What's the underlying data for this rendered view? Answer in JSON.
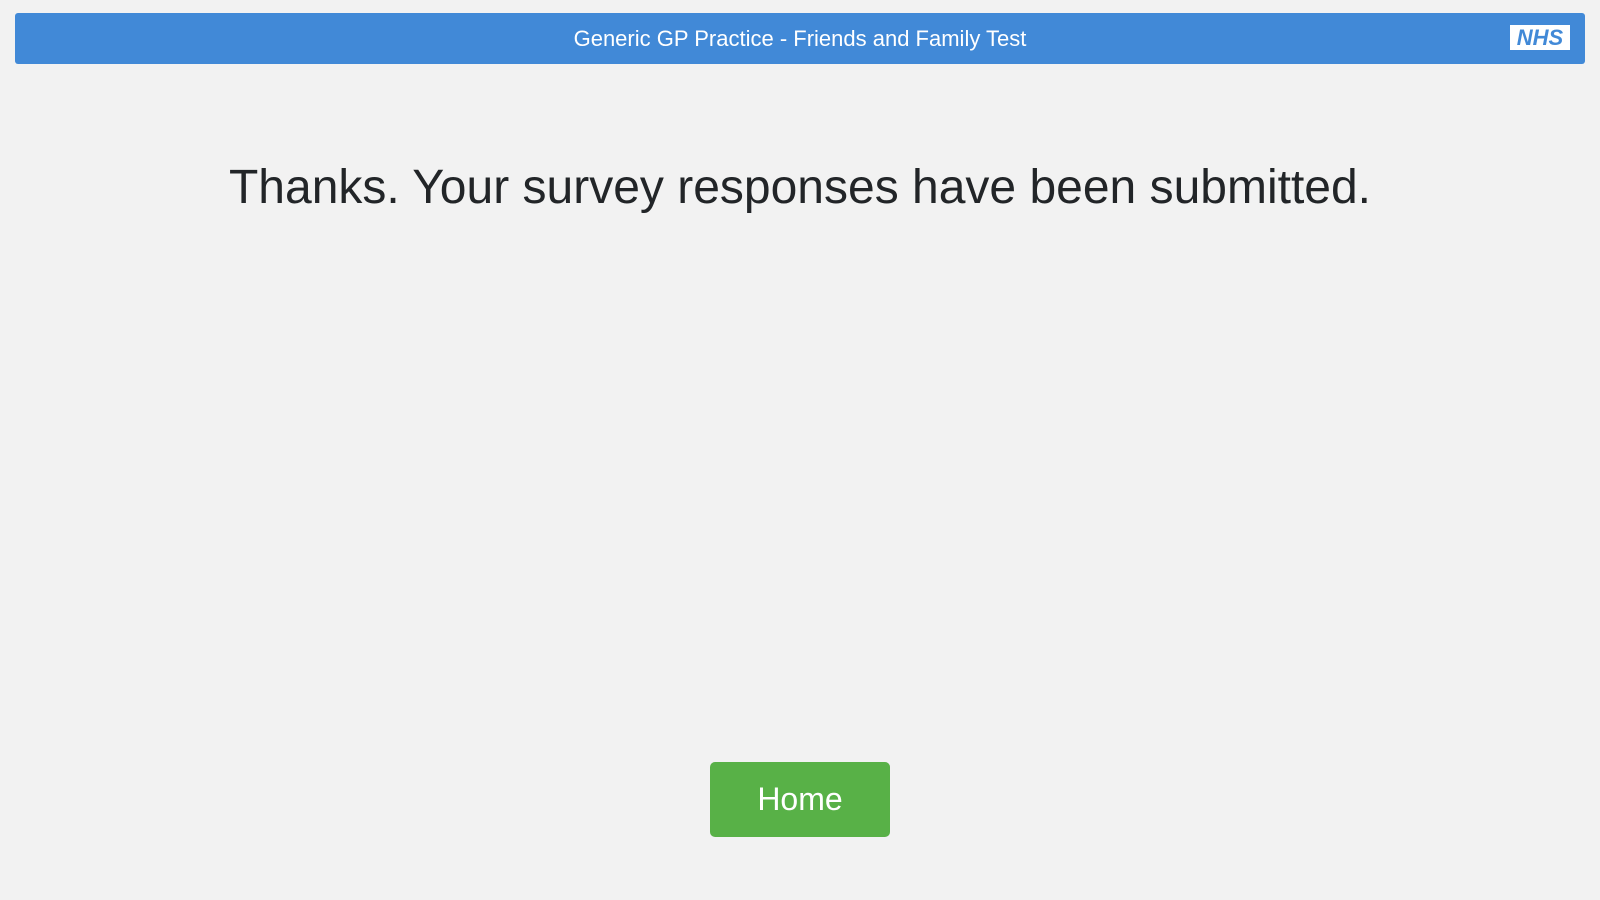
{
  "header": {
    "title": "Generic GP Practice - Friends and Family Test",
    "logo_text": "NHS",
    "background_color": "#4189d7"
  },
  "main": {
    "confirmation_message": "Thanks. Your survey responses have been submitted."
  },
  "actions": {
    "home_label": "Home",
    "home_color": "#58b147"
  }
}
